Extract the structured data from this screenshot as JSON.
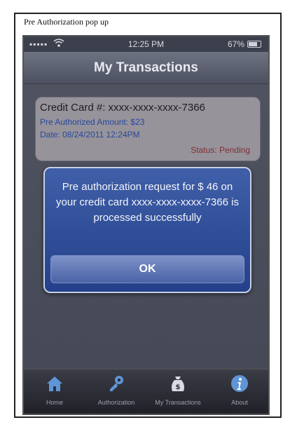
{
  "caption": "Pre Authorization pop up",
  "status_bar": {
    "signal": "▪▪▪▪▪",
    "time": "12:25 PM",
    "battery_percent": "67%"
  },
  "nav": {
    "title": "My Transactions"
  },
  "transaction": {
    "card_number": "Credit Card #: xxxx-xxxx-xxxx-7366",
    "amount": "Pre Authorized Amount: $23",
    "date": "Date: 08/24/2011 12:24PM",
    "status": "Status: Pending"
  },
  "alert": {
    "message": "Pre authorization request for $ 46 on your credit card xxxx-xxxx-xxxx-7366 is processed successfully",
    "ok_label": "OK"
  },
  "tabs": [
    {
      "label": "Home",
      "icon": "home-icon"
    },
    {
      "label": "Authorization",
      "icon": "key-icon"
    },
    {
      "label": "My Transactions",
      "icon": "money-bag-icon"
    },
    {
      "label": "About",
      "icon": "info-icon"
    }
  ],
  "colors": {
    "alert_bg": "#24408a",
    "link_text": "#2b5fd6",
    "status_pending": "#b33a3a"
  }
}
